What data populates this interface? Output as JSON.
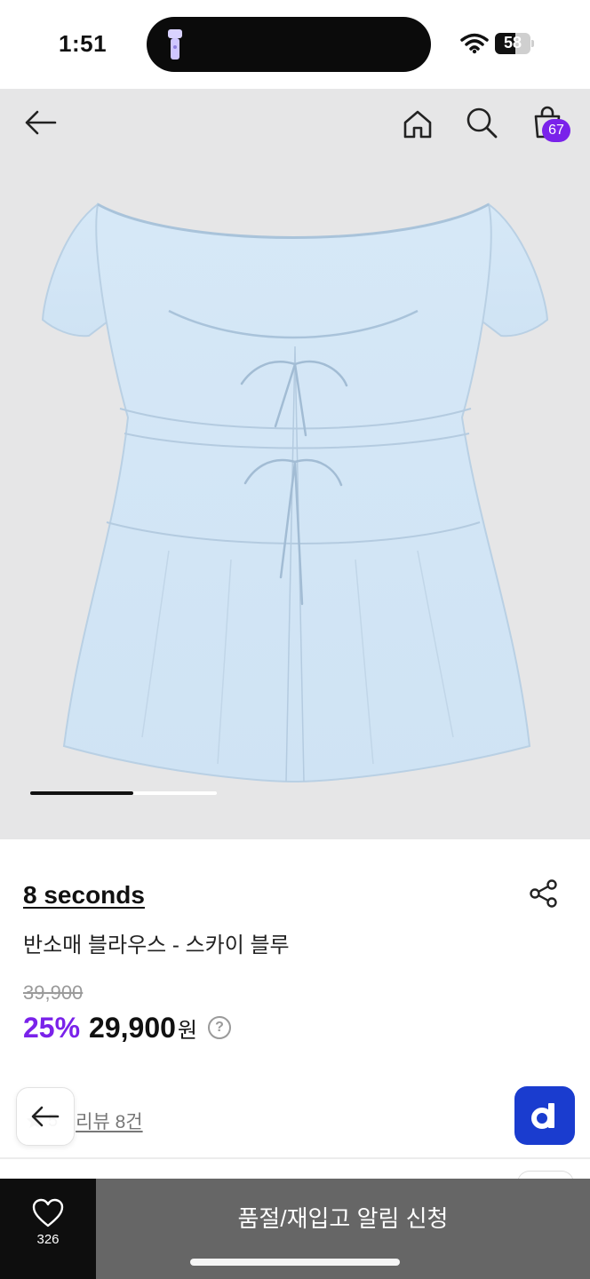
{
  "status_bar": {
    "time": "1:51",
    "battery_level": "58",
    "battery_fraction": 0.58,
    "icons": [
      "flashlight-icon",
      "wifi-icon",
      "battery-icon"
    ]
  },
  "header": {
    "icons": [
      "back-arrow-icon",
      "home-icon",
      "search-icon",
      "shopping-bag-icon"
    ],
    "cart_count": "67",
    "accent_color": "#7a22ea"
  },
  "gallery": {
    "current_image_fraction": 0.55,
    "image_subject": "light blue short-sleeve tie-front blouse"
  },
  "product": {
    "brand": "8 seconds",
    "name": "반소매 블라우스 - 스카이 블루",
    "original_price": "39,900",
    "discount": "25%",
    "sale_price": "29,900",
    "currency": "원",
    "help_label": "?"
  },
  "rating": {
    "value": "5",
    "reviews_label": "리뷰 8건"
  },
  "bottom_bar": {
    "like_count": "326",
    "notify_label": "품절/재입고 알림 신청"
  }
}
